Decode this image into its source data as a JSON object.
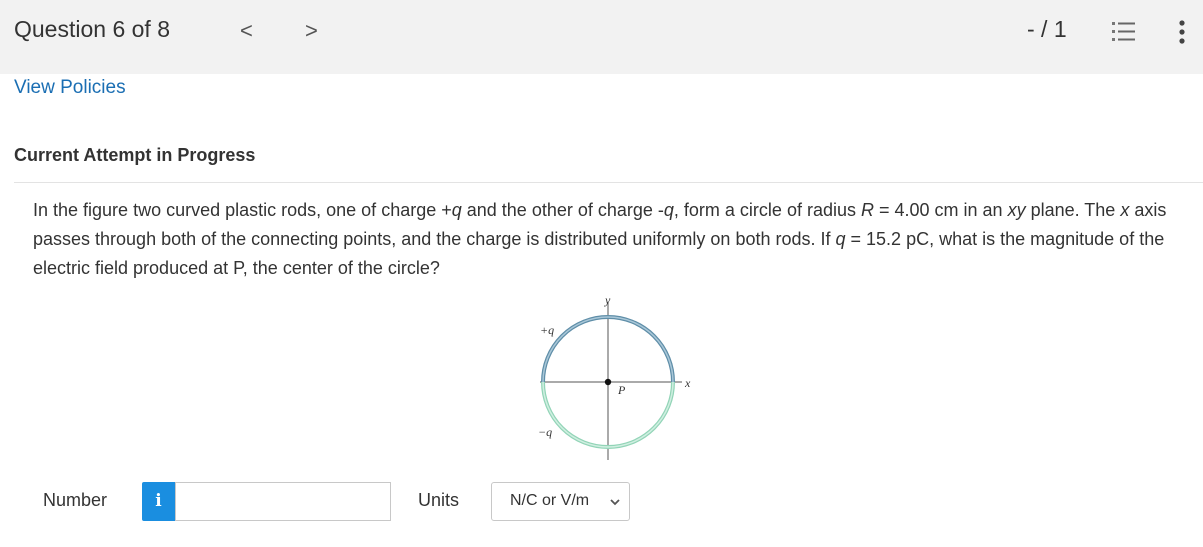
{
  "header": {
    "question_label": "Question 6 of 8",
    "prev_glyph": "<",
    "next_glyph": ">",
    "score": "- / 1"
  },
  "view_policies": "View Policies",
  "attempt_heading": "Current Attempt in Progress",
  "question": {
    "s1": "In the figure two curved plastic rods, one of charge +",
    "q1": "q",
    "s2": " and the other of charge -",
    "q2": "q",
    "s3": ", form a circle of radius ",
    "R": "R",
    "s4": " = 4.00 cm in an ",
    "xy": "xy",
    "s5": " plane. The ",
    "x": "x",
    "s6": " axis passes through both of the connecting points, and the charge is distributed uniformly on both rods. If ",
    "q3": "q",
    "s7": " = 15.2 pC, what is the magnitude of the electric field produced at P, the center of the circle?"
  },
  "figure": {
    "label_y": "y",
    "label_x": "x",
    "label_pos": "+q",
    "label_neg": "−q",
    "label_p": "P",
    "upper_rod_color": "#5f8ea8",
    "lower_rod_color": "#92d4b7"
  },
  "answer": {
    "number_label": "Number",
    "info_glyph": "i",
    "number_value": "",
    "units_label": "Units",
    "units_selected": "N/C or V/m"
  },
  "icons": {
    "list": "list-icon",
    "more": "more-vertical-icon",
    "info": "info-icon",
    "chevron": "chevron-down-icon"
  },
  "colors": {
    "link": "#1a6eb3",
    "info_button": "#1a8ee0",
    "topbar": "#f2f2f2"
  }
}
